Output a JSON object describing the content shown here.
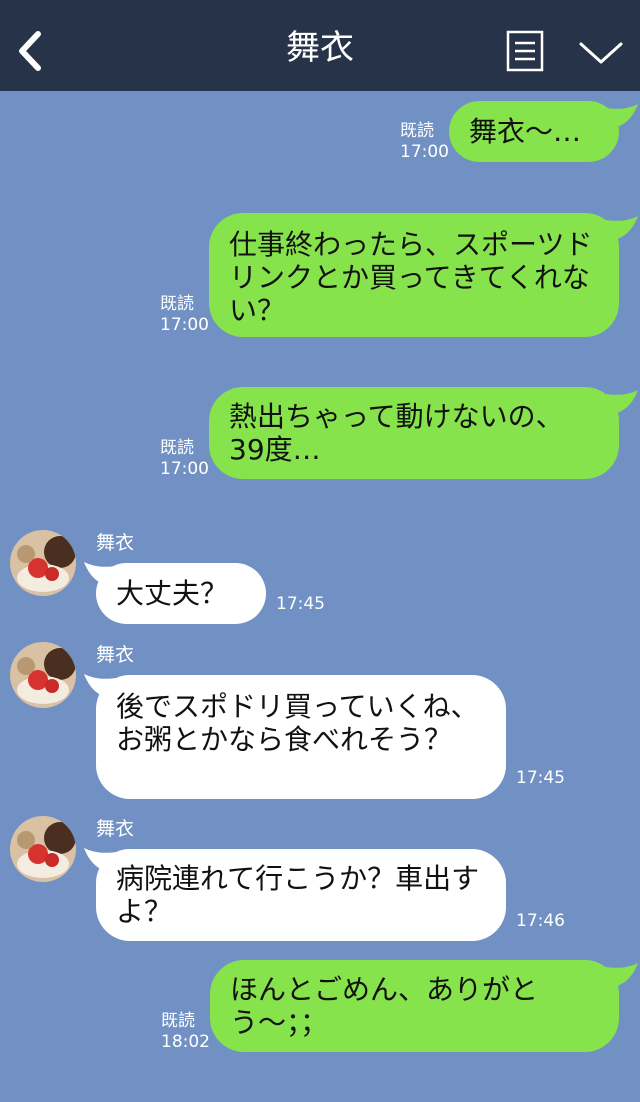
{
  "header": {
    "title": "舞衣",
    "back_icon": "chevron-left-icon",
    "menu_icon": "list-icon",
    "expand_icon": "chevron-down-icon"
  },
  "messages": [
    {
      "side": "sent",
      "text": "舞衣〜…",
      "read": "既読",
      "time": "17:00"
    },
    {
      "side": "sent",
      "text": "仕事終わったら、スポーツドリンクとか買ってきてくれない？",
      "read": "既読",
      "time": "17:00"
    },
    {
      "side": "sent",
      "text": "熱出ちゃって動けないの、39度…",
      "read": "既読",
      "time": "17:00"
    },
    {
      "side": "received",
      "sender": "舞衣",
      "text": "大丈夫？",
      "time": "17:45"
    },
    {
      "side": "received",
      "sender": "舞衣",
      "text": "後でスポドリ買っていくね、お粥とかなら食べれそう？",
      "time": "17:45"
    },
    {
      "side": "received",
      "sender": "舞衣",
      "text": "病院連れて行こうか？車出すよ？",
      "time": "17:46"
    },
    {
      "side": "sent",
      "text": "ほんとごめん、ありがとう〜；；",
      "read": "既読",
      "time": "18:02"
    }
  ],
  "colors": {
    "background": "#7191c4",
    "header": "#273348",
    "sent_bubble": "#86e34b",
    "received_bubble": "#ffffff"
  }
}
